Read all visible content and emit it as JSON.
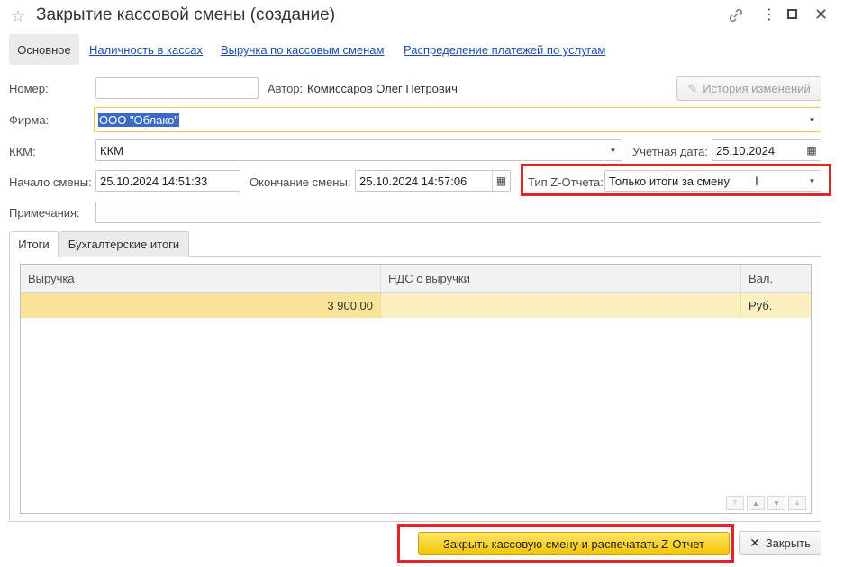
{
  "window": {
    "title": "Закрытие кассовой смены (создание)",
    "icons": [
      "star-icon",
      "link-icon",
      "more-icon",
      "maximize-icon",
      "close-icon"
    ]
  },
  "tabs": {
    "main": "Основное",
    "links": [
      "Наличность в кассах",
      "Выручка по кассовым сменам",
      "Распределение платежей по услугам"
    ]
  },
  "form": {
    "number_label": "Номер:",
    "number_value": "",
    "author_label": "Автор:",
    "author_value": "Комиссаров Олег Петрович",
    "history_button": "История изменений",
    "firm_label": "Фирма:",
    "firm_value": "ООО \"Облако\"",
    "kkm_label": "ККМ:",
    "kkm_value": "ККМ",
    "accounting_date_label": "Учетная дата:",
    "accounting_date_value": "25.10.2024",
    "shift_start_label": "Начало смены:",
    "shift_start_value": "25.10.2024 14:51:33",
    "shift_end_label": "Окончание смены:",
    "shift_end_value": "25.10.2024 14:57:06",
    "z_type_label": "Тип Z-Отчета:",
    "z_type_value": "Только итоги за смену",
    "notes_label": "Примечания:",
    "notes_value": ""
  },
  "subtabs": [
    "Итоги",
    "Бухгалтерские итоги"
  ],
  "table": {
    "columns": [
      "Выручка",
      "НДС с выручки",
      "Вал."
    ],
    "rows": [
      [
        "3 900,00",
        "",
        "Руб."
      ]
    ]
  },
  "footer": {
    "close_print_button": "Закрыть кассовую смену и распечатать Z-Отчет",
    "close_button": "Закрыть"
  },
  "colors": {
    "link": "#1f4fa8",
    "highlight_box": "#e5232b",
    "primary_button": "#f5c400",
    "selected_row": "#fdf0c0"
  }
}
